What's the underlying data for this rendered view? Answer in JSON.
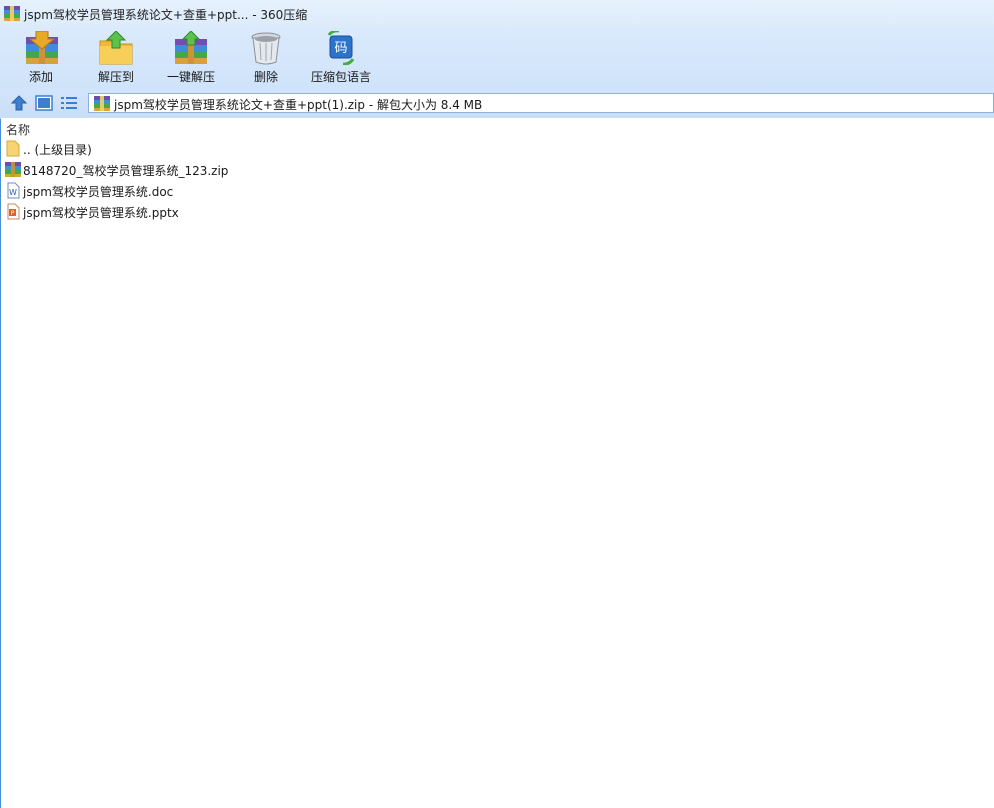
{
  "window": {
    "title": "jspm驾校学员管理系统论文+查重+ppt... - 360压缩",
    "app_icon": "archive-icon"
  },
  "toolbar": {
    "buttons": [
      {
        "label": "添加",
        "icon": "add-archive-icon"
      },
      {
        "label": "解压到",
        "icon": "extract-to-folder-icon"
      },
      {
        "label": "一键解压",
        "icon": "one-click-extract-icon"
      },
      {
        "label": "删除",
        "icon": "trash-bin-icon"
      },
      {
        "label": "压缩包语言",
        "icon": "encoding-language-icon",
        "glyph": "码"
      }
    ]
  },
  "navbar": {
    "up_icon": "up-arrow-icon",
    "view_icon": "thumbnail-view-icon",
    "list_icon": "list-view-icon",
    "address_text": "jspm驾校学员管理系统论文+查重+ppt(1).zip - 解包大小为 8.4 MB"
  },
  "file_list": {
    "column_header": "名称",
    "items": [
      {
        "name": ".. (上级目录)",
        "type": "folder",
        "icon": "folder-icon"
      },
      {
        "name": "8148720_驾校学员管理系统_123.zip",
        "type": "zip",
        "icon": "zip-archive-icon"
      },
      {
        "name": "jspm驾校学员管理系统.doc",
        "type": "doc",
        "icon": "word-document-icon"
      },
      {
        "name": "jspm驾校学员管理系统.pptx",
        "type": "pptx",
        "icon": "powerpoint-document-icon"
      }
    ]
  },
  "colors": {
    "accent_blue": "#3a7fd0",
    "toolbar_bg": "#d6e7fb",
    "folder_yellow": "#f5c84c",
    "ppt_orange": "#d9642b"
  }
}
